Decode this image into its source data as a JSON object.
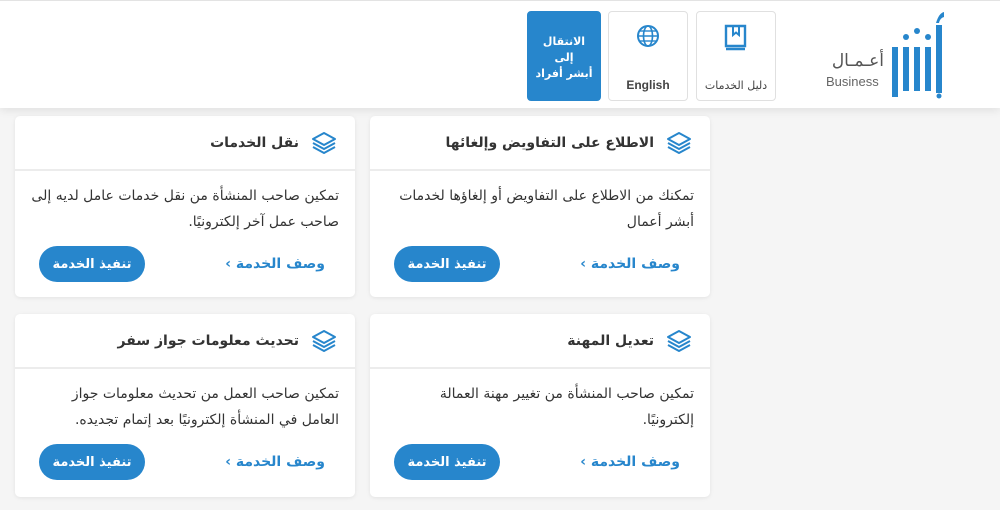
{
  "header": {
    "logo": {
      "arabic": "أعـمـال",
      "english": "Business"
    },
    "buttons": {
      "services_guide": "دليل الخدمات",
      "language": "English",
      "individuals_line1": "الانتقال إلى",
      "individuals_line2": "أبشر أفراد"
    }
  },
  "colors": {
    "primary": "#2786cc",
    "background": "#f5f5f5",
    "card": "#ffffff"
  },
  "cards": [
    {
      "title": "الاطلاع على التفاويض وإلغائها",
      "description": "تمكنك من الاطلاع على التفاويض أو إلغاؤها لخدمات أبشر أعمال",
      "desc_link": "وصف الخدمة ›",
      "run_label": "تنفيذ الخدمة",
      "icon": "layers-icon"
    },
    {
      "title": "نقل الخدمات",
      "description": "تمكين صاحب المنشأة من نقل خدمات عامل لديه إلى صاحب عمل آخر إلكترونيًا.",
      "desc_link": "وصف الخدمة ›",
      "run_label": "تنفيذ الخدمة",
      "icon": "layers-icon"
    },
    {
      "title": "تعديل المهنة",
      "description": "تمكين صاحب المنشأة من تغيير مهنة العمالة إلكترونيًا.",
      "desc_link": "وصف الخدمة ›",
      "run_label": "تنفيذ الخدمة",
      "icon": "layers-icon"
    },
    {
      "title": "تحديث معلومات جواز سفر",
      "description": "تمكين صاحب العمل من تحديث معلومات جواز العامل في المنشأة إلكترونيًا بعد إتمام تجديده.",
      "desc_link": "وصف الخدمة ›",
      "run_label": "تنفيذ الخدمة",
      "icon": "layers-icon"
    }
  ]
}
